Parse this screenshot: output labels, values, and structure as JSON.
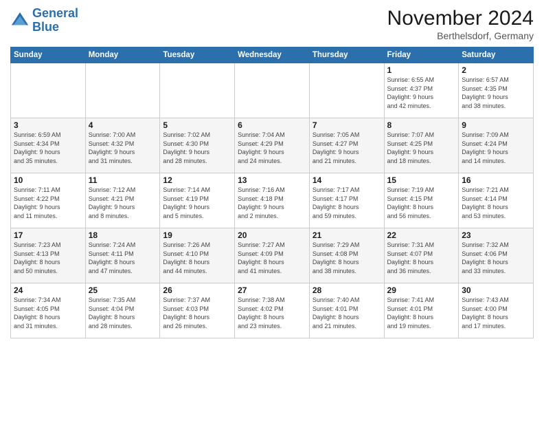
{
  "header": {
    "logo_line1": "General",
    "logo_line2": "Blue",
    "month_title": "November 2024",
    "location": "Berthelsdorf, Germany"
  },
  "weekdays": [
    "Sunday",
    "Monday",
    "Tuesday",
    "Wednesday",
    "Thursday",
    "Friday",
    "Saturday"
  ],
  "weeks": [
    [
      {
        "day": "",
        "info": ""
      },
      {
        "day": "",
        "info": ""
      },
      {
        "day": "",
        "info": ""
      },
      {
        "day": "",
        "info": ""
      },
      {
        "day": "",
        "info": ""
      },
      {
        "day": "1",
        "info": "Sunrise: 6:55 AM\nSunset: 4:37 PM\nDaylight: 9 hours\nand 42 minutes."
      },
      {
        "day": "2",
        "info": "Sunrise: 6:57 AM\nSunset: 4:35 PM\nDaylight: 9 hours\nand 38 minutes."
      }
    ],
    [
      {
        "day": "3",
        "info": "Sunrise: 6:59 AM\nSunset: 4:34 PM\nDaylight: 9 hours\nand 35 minutes."
      },
      {
        "day": "4",
        "info": "Sunrise: 7:00 AM\nSunset: 4:32 PM\nDaylight: 9 hours\nand 31 minutes."
      },
      {
        "day": "5",
        "info": "Sunrise: 7:02 AM\nSunset: 4:30 PM\nDaylight: 9 hours\nand 28 minutes."
      },
      {
        "day": "6",
        "info": "Sunrise: 7:04 AM\nSunset: 4:29 PM\nDaylight: 9 hours\nand 24 minutes."
      },
      {
        "day": "7",
        "info": "Sunrise: 7:05 AM\nSunset: 4:27 PM\nDaylight: 9 hours\nand 21 minutes."
      },
      {
        "day": "8",
        "info": "Sunrise: 7:07 AM\nSunset: 4:25 PM\nDaylight: 9 hours\nand 18 minutes."
      },
      {
        "day": "9",
        "info": "Sunrise: 7:09 AM\nSunset: 4:24 PM\nDaylight: 9 hours\nand 14 minutes."
      }
    ],
    [
      {
        "day": "10",
        "info": "Sunrise: 7:11 AM\nSunset: 4:22 PM\nDaylight: 9 hours\nand 11 minutes."
      },
      {
        "day": "11",
        "info": "Sunrise: 7:12 AM\nSunset: 4:21 PM\nDaylight: 9 hours\nand 8 minutes."
      },
      {
        "day": "12",
        "info": "Sunrise: 7:14 AM\nSunset: 4:19 PM\nDaylight: 9 hours\nand 5 minutes."
      },
      {
        "day": "13",
        "info": "Sunrise: 7:16 AM\nSunset: 4:18 PM\nDaylight: 9 hours\nand 2 minutes."
      },
      {
        "day": "14",
        "info": "Sunrise: 7:17 AM\nSunset: 4:17 PM\nDaylight: 8 hours\nand 59 minutes."
      },
      {
        "day": "15",
        "info": "Sunrise: 7:19 AM\nSunset: 4:15 PM\nDaylight: 8 hours\nand 56 minutes."
      },
      {
        "day": "16",
        "info": "Sunrise: 7:21 AM\nSunset: 4:14 PM\nDaylight: 8 hours\nand 53 minutes."
      }
    ],
    [
      {
        "day": "17",
        "info": "Sunrise: 7:23 AM\nSunset: 4:13 PM\nDaylight: 8 hours\nand 50 minutes."
      },
      {
        "day": "18",
        "info": "Sunrise: 7:24 AM\nSunset: 4:11 PM\nDaylight: 8 hours\nand 47 minutes."
      },
      {
        "day": "19",
        "info": "Sunrise: 7:26 AM\nSunset: 4:10 PM\nDaylight: 8 hours\nand 44 minutes."
      },
      {
        "day": "20",
        "info": "Sunrise: 7:27 AM\nSunset: 4:09 PM\nDaylight: 8 hours\nand 41 minutes."
      },
      {
        "day": "21",
        "info": "Sunrise: 7:29 AM\nSunset: 4:08 PM\nDaylight: 8 hours\nand 38 minutes."
      },
      {
        "day": "22",
        "info": "Sunrise: 7:31 AM\nSunset: 4:07 PM\nDaylight: 8 hours\nand 36 minutes."
      },
      {
        "day": "23",
        "info": "Sunrise: 7:32 AM\nSunset: 4:06 PM\nDaylight: 8 hours\nand 33 minutes."
      }
    ],
    [
      {
        "day": "24",
        "info": "Sunrise: 7:34 AM\nSunset: 4:05 PM\nDaylight: 8 hours\nand 31 minutes."
      },
      {
        "day": "25",
        "info": "Sunrise: 7:35 AM\nSunset: 4:04 PM\nDaylight: 8 hours\nand 28 minutes."
      },
      {
        "day": "26",
        "info": "Sunrise: 7:37 AM\nSunset: 4:03 PM\nDaylight: 8 hours\nand 26 minutes."
      },
      {
        "day": "27",
        "info": "Sunrise: 7:38 AM\nSunset: 4:02 PM\nDaylight: 8 hours\nand 23 minutes."
      },
      {
        "day": "28",
        "info": "Sunrise: 7:40 AM\nSunset: 4:01 PM\nDaylight: 8 hours\nand 21 minutes."
      },
      {
        "day": "29",
        "info": "Sunrise: 7:41 AM\nSunset: 4:01 PM\nDaylight: 8 hours\nand 19 minutes."
      },
      {
        "day": "30",
        "info": "Sunrise: 7:43 AM\nSunset: 4:00 PM\nDaylight: 8 hours\nand 17 minutes."
      }
    ]
  ]
}
